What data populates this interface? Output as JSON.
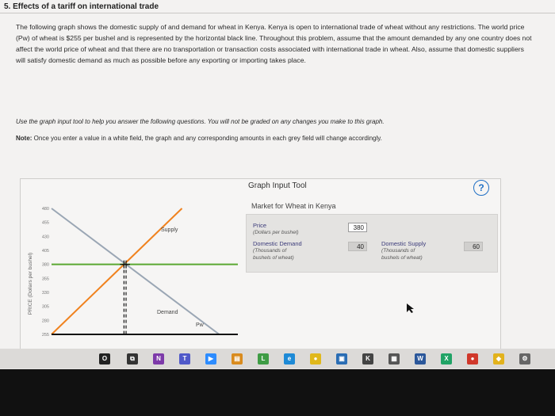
{
  "question": {
    "title": "5. Effects of a tariff on international trade",
    "paragraph": "The following graph shows the domestic supply of and demand for wheat in Kenya. Kenya is open to international trade of wheat without any restrictions. The world price (Pw) of wheat is $255 per bushel and is represented by the horizontal black line. Throughout this problem, assume that the amount demanded by any one country does not affect the world price of wheat and that there are no transportation or transaction costs associated with international trade in wheat. Also, assume that domestic suppliers will satisfy domestic demand as much as possible before any exporting or importing takes place.",
    "instruction": "Use the graph input tool to help you answer the following questions. You will not be graded on any changes you make to this graph.",
    "note_label": "Note:",
    "note_text": " Once you enter a value in a white field, the graph and any corresponding amounts in each grey field will change accordingly."
  },
  "chart_data": {
    "type": "line",
    "ylabel": "PRICE (Dollars per bushel)",
    "yticks": [
      480,
      455,
      430,
      405,
      380,
      355,
      330,
      305,
      280,
      255
    ],
    "series": [
      {
        "name": "Supply",
        "color": "#f0821e",
        "points": [
          [
            0,
            255
          ],
          [
            140,
            480
          ]
        ]
      },
      {
        "name": "Demand",
        "color": "#9aa6b4",
        "points": [
          [
            0,
            480
          ],
          [
            180,
            255
          ]
        ]
      }
    ],
    "lines": [
      {
        "name": "green-line",
        "color": "#5aa832",
        "y": 380
      },
      {
        "name": "Pw",
        "color": "#111111",
        "y": 255
      }
    ],
    "labels": {
      "supply": "Supply",
      "demand": "Demand",
      "pw": "Pw"
    }
  },
  "tool": {
    "title": "Graph Input Tool",
    "help": "?",
    "market": "Market for Wheat in Kenya",
    "price_label": "Price",
    "price_sub": "(Dollars per bushel)",
    "price_value": "380",
    "dd_label": "Domestic Demand",
    "dd_sub1": "(Thousands of",
    "dd_sub2": "bushels of wheat)",
    "dd_value": "40",
    "ds_label": "Domestic Supply",
    "ds_sub1": "(Thousands of",
    "ds_sub2": "bushels of wheat)",
    "ds_value": "60"
  },
  "taskbar": {
    "icons": [
      {
        "name": "start-circle-icon",
        "label": "O",
        "color": "#222"
      },
      {
        "name": "task-view-icon",
        "label": "⧉",
        "color": "#333"
      },
      {
        "name": "onenote-icon",
        "label": "N",
        "color": "#7d3aa9"
      },
      {
        "name": "teams-icon",
        "label": "T",
        "color": "#5059c9"
      },
      {
        "name": "zoom-icon",
        "label": "▶",
        "color": "#2d8cff"
      },
      {
        "name": "app-icon",
        "label": "▤",
        "color": "#d98b1e"
      },
      {
        "name": "app-green-icon",
        "label": "L",
        "color": "#3f9c45"
      },
      {
        "name": "edge-icon",
        "label": "e",
        "color": "#1e8ad6"
      },
      {
        "name": "chrome-icon",
        "label": "●",
        "color": "#e0b81c"
      },
      {
        "name": "store-icon",
        "label": "▣",
        "color": "#2a6db4"
      },
      {
        "name": "app-k-icon",
        "label": "K",
        "color": "#444"
      },
      {
        "name": "calculator-icon",
        "label": "▦",
        "color": "#555"
      },
      {
        "name": "word-icon",
        "label": "W",
        "color": "#2b579a"
      },
      {
        "name": "excel-icon",
        "label": "X",
        "color": "#21a366"
      },
      {
        "name": "app-red-icon",
        "label": "●",
        "color": "#d0382b"
      },
      {
        "name": "app-yellow-icon",
        "label": "◆",
        "color": "#e2b21d"
      },
      {
        "name": "settings-icon",
        "label": "⚙",
        "color": "#666"
      }
    ]
  }
}
